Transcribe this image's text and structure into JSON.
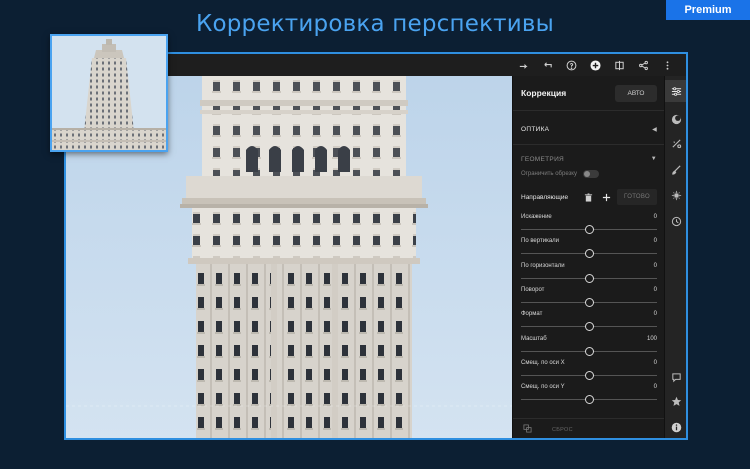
{
  "premium_badge": "Premium",
  "headline": "Корректировка перспективы",
  "topbar_icons": [
    "redo-icon",
    "undo-icon",
    "help-icon",
    "add-icon",
    "compare-icon",
    "share-icon",
    "more-icon"
  ],
  "panel": {
    "title": "Коррекция",
    "auto_button": "АВТО",
    "optics_label": "ОПТИКА",
    "geometry_label": "ГЕОМЕТРИЯ",
    "limit_crop_label": "Ограничить обрезку",
    "limit_crop_on": false,
    "guides_label": "Направляющие",
    "done_button": "ГОТОВО",
    "sliders": [
      {
        "label": "Искажение",
        "value": "0",
        "position": 0.5
      },
      {
        "label": "По вертикали",
        "value": "0",
        "position": 0.5
      },
      {
        "label": "По горизонтали",
        "value": "0",
        "position": 0.5
      },
      {
        "label": "Поворот",
        "value": "0",
        "position": 0.5
      },
      {
        "label": "Формат",
        "value": "0",
        "position": 0.5
      },
      {
        "label": "Масштаб",
        "value": "100",
        "position": 0.5
      },
      {
        "label": "Смещ. по оси X",
        "value": "0",
        "position": 0.5
      },
      {
        "label": "Смещ. по оси Y",
        "value": "0",
        "position": 0.5
      }
    ],
    "reset_label": "СБРОС"
  },
  "rail_icons": [
    "sliders-icon",
    "color-icon",
    "healing-icon",
    "brush-icon",
    "geometry-icon",
    "history-icon",
    "comment-icon",
    "star-icon",
    "info-icon"
  ],
  "colors": {
    "accent": "#2f8fe0",
    "premium": "#1a73e8",
    "headline": "#4aa3f0",
    "background": "#0c1f33"
  }
}
